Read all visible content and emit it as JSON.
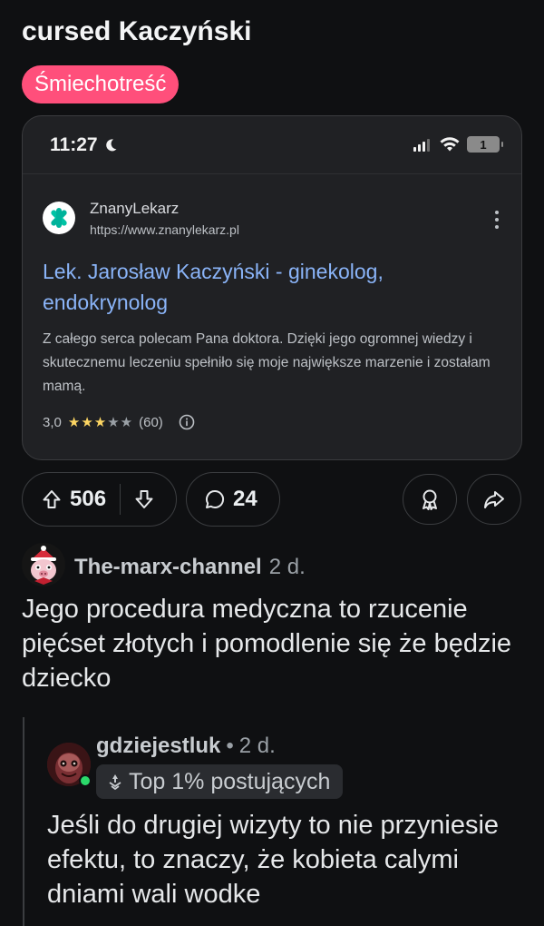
{
  "post": {
    "title": "cursed Kaczyński",
    "flair": "Śmiechotreść",
    "flair_color": "#ff4f7b"
  },
  "screenshot": {
    "time": "11:27",
    "battery": "1",
    "site_name": "ZnanyLekarz",
    "site_url": "https://www.znanylekarz.pl",
    "result_title": "Lek. Jarosław Kaczyński - ginekolog, endokrynolog",
    "snippet": "Z całego serca polecam Pana doktora. Dzięki jego ogromnej wiedzy i skutecznemu leczeniu spełniło się moje największe marzenie i zostałam mamą.",
    "rating_value": "3,0",
    "rating_stars": 3,
    "rating_max": 5,
    "rating_count": "(60)",
    "link_color": "#8ab4f8",
    "star_color": "#fdd663"
  },
  "actions": {
    "upvote_icon": "arrow-up-icon",
    "vote_count": "506",
    "downvote_icon": "arrow-down-icon",
    "comment_icon": "speech-bubble-icon",
    "comment_count": "24",
    "award_icon": "award-icon",
    "share_icon": "share-icon"
  },
  "comments": [
    {
      "author": "The-marx-channel",
      "age": "2 d.",
      "text": "Jego procedura medyczna to rzucenie pięćset złotych i pomodlenie się że będzie dziecko"
    },
    {
      "author": "gdziejestluk",
      "separator": "•",
      "age": "2 d.",
      "flair": "Top 1% postujących",
      "text": "Jeśli do drugiej wizyty to nie przyniesie efektu, to znaczy, że kobieta calymi dniami wali wodke",
      "online": true,
      "online_color": "#2bd96a"
    }
  ]
}
